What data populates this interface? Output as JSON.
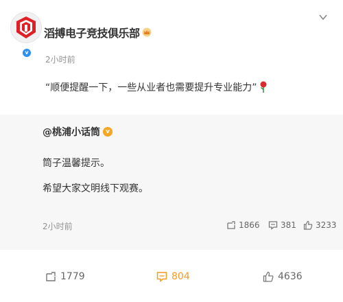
{
  "post": {
    "author": "滔搏电子竞技俱乐部",
    "time": "2小时前",
    "content": "“顺便提醒一下，一些从业者也需要提升专业能力”"
  },
  "repost": {
    "author": "@桃浦小话筒",
    "lines": [
      "筒子温馨提示。",
      "希望大家文明线下观赛。"
    ],
    "time": "2小时前",
    "repost_count": "1866",
    "comment_count": "381",
    "like_count": "3233"
  },
  "footer": {
    "repost_count": "1779",
    "comment_count": "804",
    "like_count": "4636"
  },
  "colors": {
    "accent": "#f59a23",
    "verified": "#2e8ff5",
    "repost_bg": "#f7f7f7"
  },
  "icons": {
    "crown": "crown-icon",
    "verified": "verified-icon",
    "rose": "rose-icon",
    "chevron": "chevron-down-icon",
    "repost": "repost-icon",
    "comment": "comment-icon",
    "like": "like-icon"
  }
}
